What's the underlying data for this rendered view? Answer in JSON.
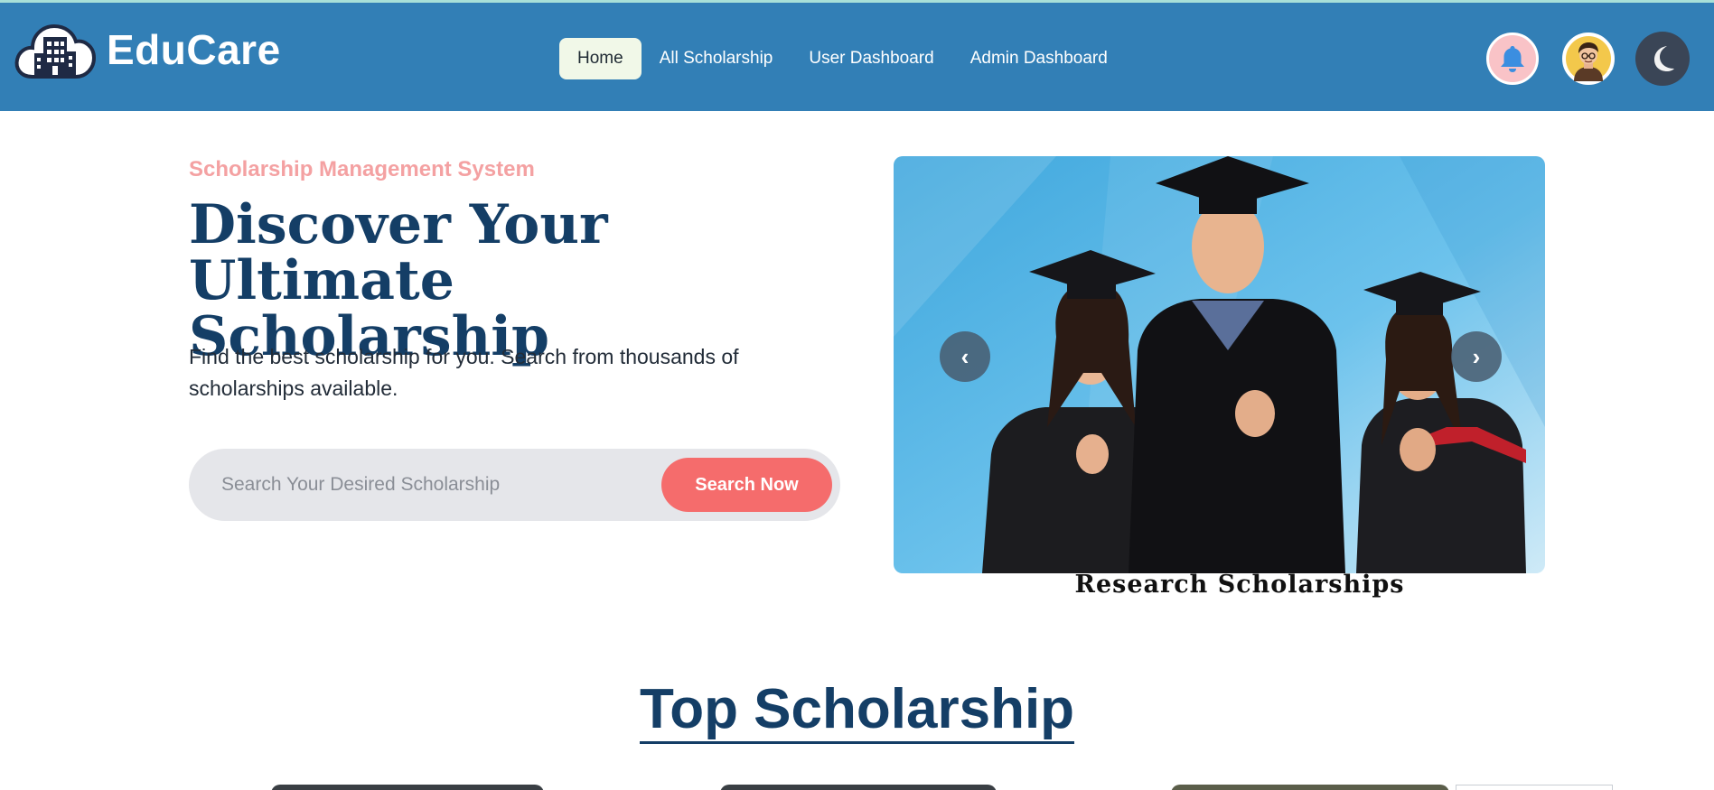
{
  "brand": {
    "name": "EduCare",
    "logo_icon": "cloud-building-icon"
  },
  "nav": {
    "items": [
      {
        "label": "Home",
        "active": true
      },
      {
        "label": "All Scholarship",
        "active": false
      },
      {
        "label": "User Dashboard",
        "active": false
      },
      {
        "label": "Admin Dashboard",
        "active": false
      }
    ]
  },
  "header_actions": {
    "notification_icon": "bell-icon",
    "avatar_icon": "user-avatar-icon",
    "theme_icon": "moon-icon"
  },
  "hero": {
    "eyebrow": "Scholarship Management System",
    "title": "Discover Your Ultimate Scholarship",
    "description": "Find the best scholarship for you. Search from thousands of scholarships available.",
    "search": {
      "placeholder": "Search Your Desired Scholarship",
      "value": "",
      "button_label": "Search Now"
    }
  },
  "carousel": {
    "caption": "Research Scholarships",
    "prev_icon": "chevron-left-icon",
    "next_icon": "chevron-right-icon",
    "prev_glyph": "‹",
    "next_glyph": "›"
  },
  "section": {
    "title": "Top Scholarship"
  },
  "colors": {
    "header_bg": "#327fb6",
    "accent_red": "#f56c6c",
    "eyebrow_pink": "#f4a1a2",
    "heading_navy": "#143e66",
    "search_bg": "#e5e6ea"
  }
}
